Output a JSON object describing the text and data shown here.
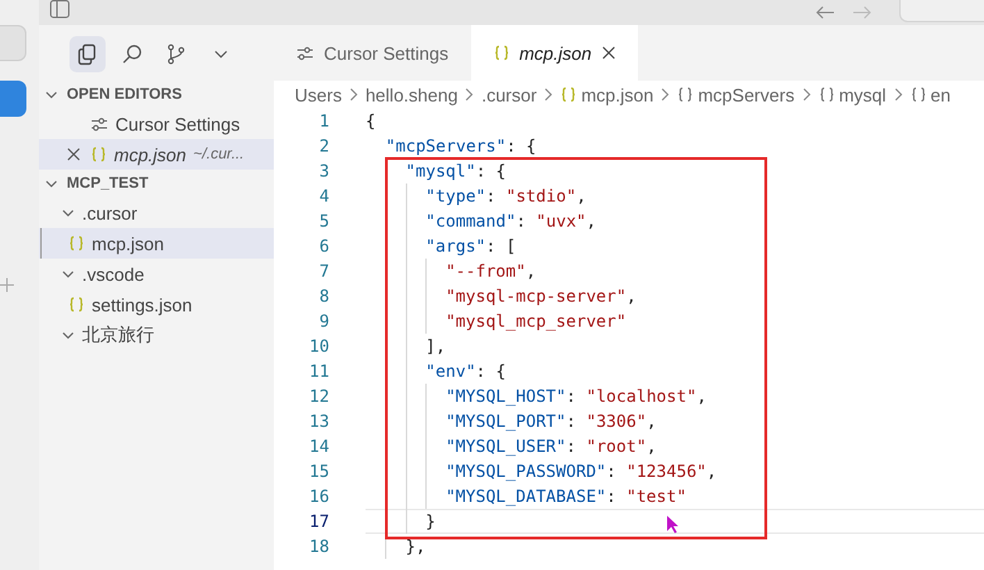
{
  "sidebar": {
    "toolbar": [
      {
        "kind": "files",
        "selected": true
      },
      {
        "kind": "search",
        "selected": false
      },
      {
        "kind": "branch",
        "selected": false
      },
      {
        "kind": "chevron",
        "selected": false
      }
    ],
    "open_editors": {
      "title": "OPEN EDITORS",
      "expanded": true,
      "items": [
        {
          "kind": "settings",
          "label": "Cursor Settings",
          "selected": false
        },
        {
          "kind": "json",
          "label": "mcp.json",
          "detail": "~/.cur...",
          "selected": true
        }
      ]
    },
    "folder": {
      "title": "MCP_TEST",
      "expanded": true,
      "items": [
        {
          "label": ".cursor",
          "expanded": true,
          "selected": false,
          "children": [
            {
              "label": "mcp.json",
              "kind": "json",
              "selected": true
            }
          ]
        },
        {
          "label": ".vscode",
          "expanded": true,
          "selected": false,
          "children": [
            {
              "label": "settings.json",
              "kind": "json",
              "selected": false
            }
          ]
        },
        {
          "label": "北京旅行",
          "expanded": true,
          "selected": false
        }
      ]
    }
  },
  "tabs": [
    {
      "kind": "settings",
      "label": "Cursor Settings",
      "selected": false
    },
    {
      "kind": "json",
      "label": "mcp.json",
      "selected": true
    }
  ],
  "breadcrumb": [
    {
      "kind": "text",
      "label": "Users"
    },
    {
      "kind": "text",
      "label": "hello.sheng"
    },
    {
      "kind": "text",
      "label": ".cursor"
    },
    {
      "kind": "json",
      "label": "mcp.json"
    },
    {
      "kind": "object",
      "label": "mcpServers"
    },
    {
      "kind": "object",
      "label": "mysql"
    },
    {
      "kind": "object",
      "label": "en"
    }
  ],
  "code": [
    {
      "number": "1",
      "current": false,
      "tokens": [
        {
          "kind": "punct",
          "text": "{"
        }
      ],
      "children": [
        {
          "number": "2",
          "current": false,
          "tokens": [
            {
              "kind": "key",
              "text": "\"mcpServers\""
            },
            {
              "kind": "punct",
              "text": ": {"
            }
          ],
          "children": [
            {
              "number": "3",
              "current": false,
              "tokens": [
                {
                  "kind": "key",
                  "text": "\"mysql\""
                },
                {
                  "kind": "punct",
                  "text": ": {"
                }
              ],
              "children": [
                {
                  "number": "4",
                  "current": false,
                  "tokens": [
                    {
                      "kind": "key",
                      "text": "\"type\""
                    },
                    {
                      "kind": "punct",
                      "text": ": "
                    },
                    {
                      "kind": "string",
                      "text": "\"stdio\""
                    },
                    {
                      "kind": "punct",
                      "text": ","
                    }
                  ]
                },
                {
                  "number": "5",
                  "current": false,
                  "tokens": [
                    {
                      "kind": "key",
                      "text": "\"command\""
                    },
                    {
                      "kind": "punct",
                      "text": ": "
                    },
                    {
                      "kind": "string",
                      "text": "\"uvx\""
                    },
                    {
                      "kind": "punct",
                      "text": ","
                    }
                  ]
                },
                {
                  "number": "6",
                  "current": false,
                  "tokens": [
                    {
                      "kind": "key",
                      "text": "\"args\""
                    },
                    {
                      "kind": "punct",
                      "text": ": ["
                    }
                  ],
                  "children": [
                    {
                      "number": "7",
                      "current": false,
                      "tokens": [
                        {
                          "kind": "string",
                          "text": "\"--from\""
                        },
                        {
                          "kind": "punct",
                          "text": ","
                        }
                      ]
                    },
                    {
                      "number": "8",
                      "current": false,
                      "tokens": [
                        {
                          "kind": "string",
                          "text": "\"mysql-mcp-server\""
                        },
                        {
                          "kind": "punct",
                          "text": ","
                        }
                      ]
                    },
                    {
                      "number": "9",
                      "current": false,
                      "tokens": [
                        {
                          "kind": "string",
                          "text": "\"mysql_mcp_server\""
                        }
                      ]
                    }
                  ]
                },
                {
                  "number": "10",
                  "current": false,
                  "tokens": [
                    {
                      "kind": "punct",
                      "text": "],"
                    }
                  ]
                },
                {
                  "number": "11",
                  "current": false,
                  "tokens": [
                    {
                      "kind": "key",
                      "text": "\"env\""
                    },
                    {
                      "kind": "punct",
                      "text": ": {"
                    }
                  ],
                  "children": [
                    {
                      "number": "12",
                      "current": false,
                      "tokens": [
                        {
                          "kind": "key",
                          "text": "\"MYSQL_HOST\""
                        },
                        {
                          "kind": "punct",
                          "text": ": "
                        },
                        {
                          "kind": "string",
                          "text": "\"localhost\""
                        },
                        {
                          "kind": "punct",
                          "text": ","
                        }
                      ]
                    },
                    {
                      "number": "13",
                      "current": false,
                      "tokens": [
                        {
                          "kind": "key",
                          "text": "\"MYSQL_PORT\""
                        },
                        {
                          "kind": "punct",
                          "text": ": "
                        },
                        {
                          "kind": "string",
                          "text": "\"3306\""
                        },
                        {
                          "kind": "punct",
                          "text": ","
                        }
                      ]
                    },
                    {
                      "number": "14",
                      "current": false,
                      "tokens": [
                        {
                          "kind": "key",
                          "text": "\"MYSQL_USER\""
                        },
                        {
                          "kind": "punct",
                          "text": ": "
                        },
                        {
                          "kind": "string",
                          "text": "\"root\""
                        },
                        {
                          "kind": "punct",
                          "text": ","
                        }
                      ]
                    },
                    {
                      "number": "15",
                      "current": false,
                      "tokens": [
                        {
                          "kind": "key",
                          "text": "\"MYSQL_PASSWORD\""
                        },
                        {
                          "kind": "punct",
                          "text": ": "
                        },
                        {
                          "kind": "string",
                          "text": "\"123456\""
                        },
                        {
                          "kind": "punct",
                          "text": ","
                        }
                      ]
                    },
                    {
                      "number": "16",
                      "current": false,
                      "tokens": [
                        {
                          "kind": "key",
                          "text": "\"MYSQL_DATABASE\""
                        },
                        {
                          "kind": "punct",
                          "text": ": "
                        },
                        {
                          "kind": "string",
                          "text": "\"test\""
                        }
                      ]
                    }
                  ]
                },
                {
                  "number": "17",
                  "current": true,
                  "tokens": [
                    {
                      "kind": "punct",
                      "text": "}"
                    }
                  ]
                }
              ]
            },
            {
              "number": "18",
              "current": false,
              "tokens": [
                {
                  "kind": "punct",
                  "text": "},"
                }
              ]
            }
          ]
        }
      ]
    }
  ]
}
